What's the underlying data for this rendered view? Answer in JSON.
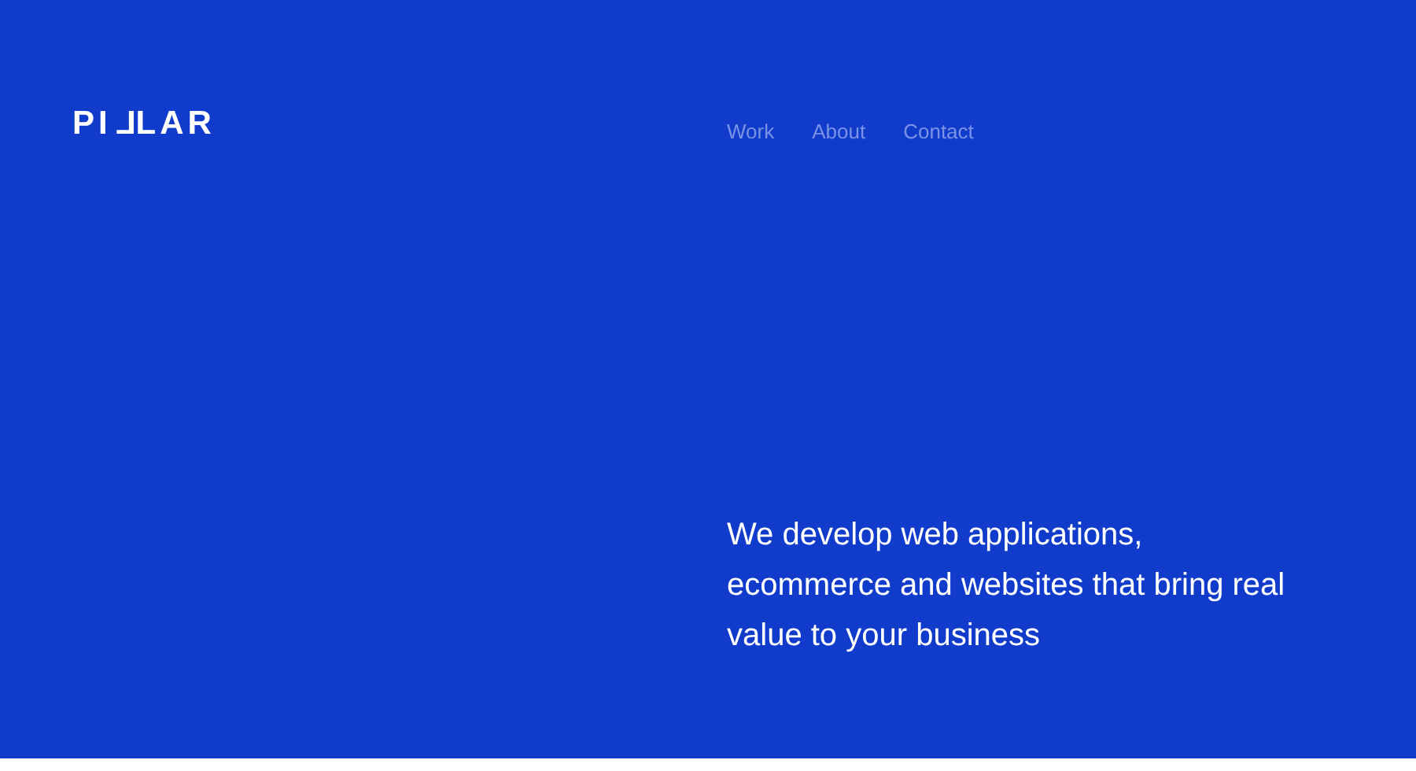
{
  "logo": "PILLAR",
  "nav": [
    {
      "label": "Work"
    },
    {
      "label": "About"
    },
    {
      "label": "Contact"
    }
  ],
  "tagline": "We develop web applications, ecommerce and websites that bring real value to your business"
}
